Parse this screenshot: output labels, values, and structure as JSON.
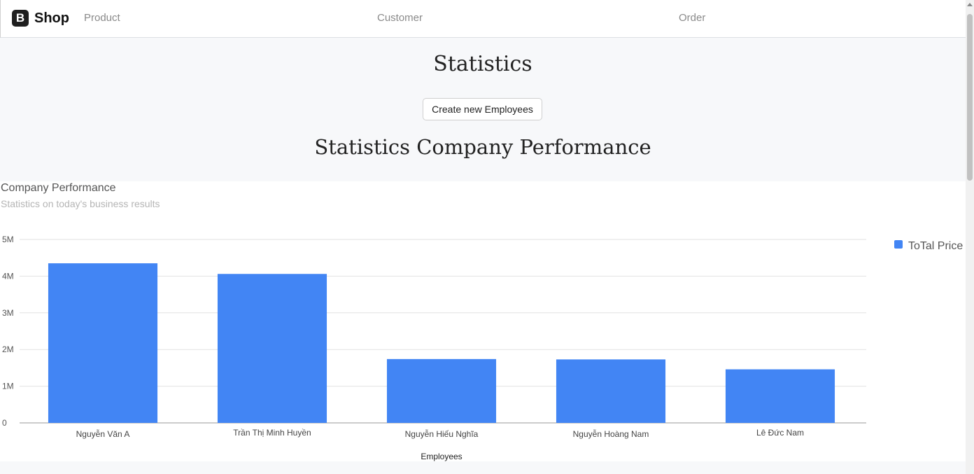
{
  "navbar": {
    "brand_letter": "B",
    "brand_name": "Shop",
    "links": [
      "Product",
      "Customer",
      "Order"
    ]
  },
  "page": {
    "title": "Statistics",
    "create_button": "Create new Employees",
    "section_title": "Statistics Company Performance"
  },
  "colors": {
    "bar": "#4285f4",
    "background": "#f7f8fa"
  },
  "chart_data": {
    "type": "bar",
    "title": "Company Performance",
    "subtitle": "Statistics on today's business results",
    "xlabel": "Employees",
    "ylabel": "",
    "categories": [
      "Nguyễn Văn A",
      "Trần Thị Minh Huyền",
      "Nguyễn Hiếu Nghĩa",
      "Nguyễn Hoàng Nam",
      "Lê Đức Nam"
    ],
    "series": [
      {
        "name": "ToTal Price",
        "values": [
          4350000,
          4060000,
          1740000,
          1730000,
          1460000
        ]
      }
    ],
    "ylim": [
      0,
      5000000
    ],
    "yticks": [
      0,
      1000000,
      2000000,
      3000000,
      4000000,
      5000000
    ],
    "ytick_labels": [
      "0",
      "1M",
      "2M",
      "3M",
      "4M",
      "5M"
    ],
    "grid": true,
    "legend": "right"
  }
}
